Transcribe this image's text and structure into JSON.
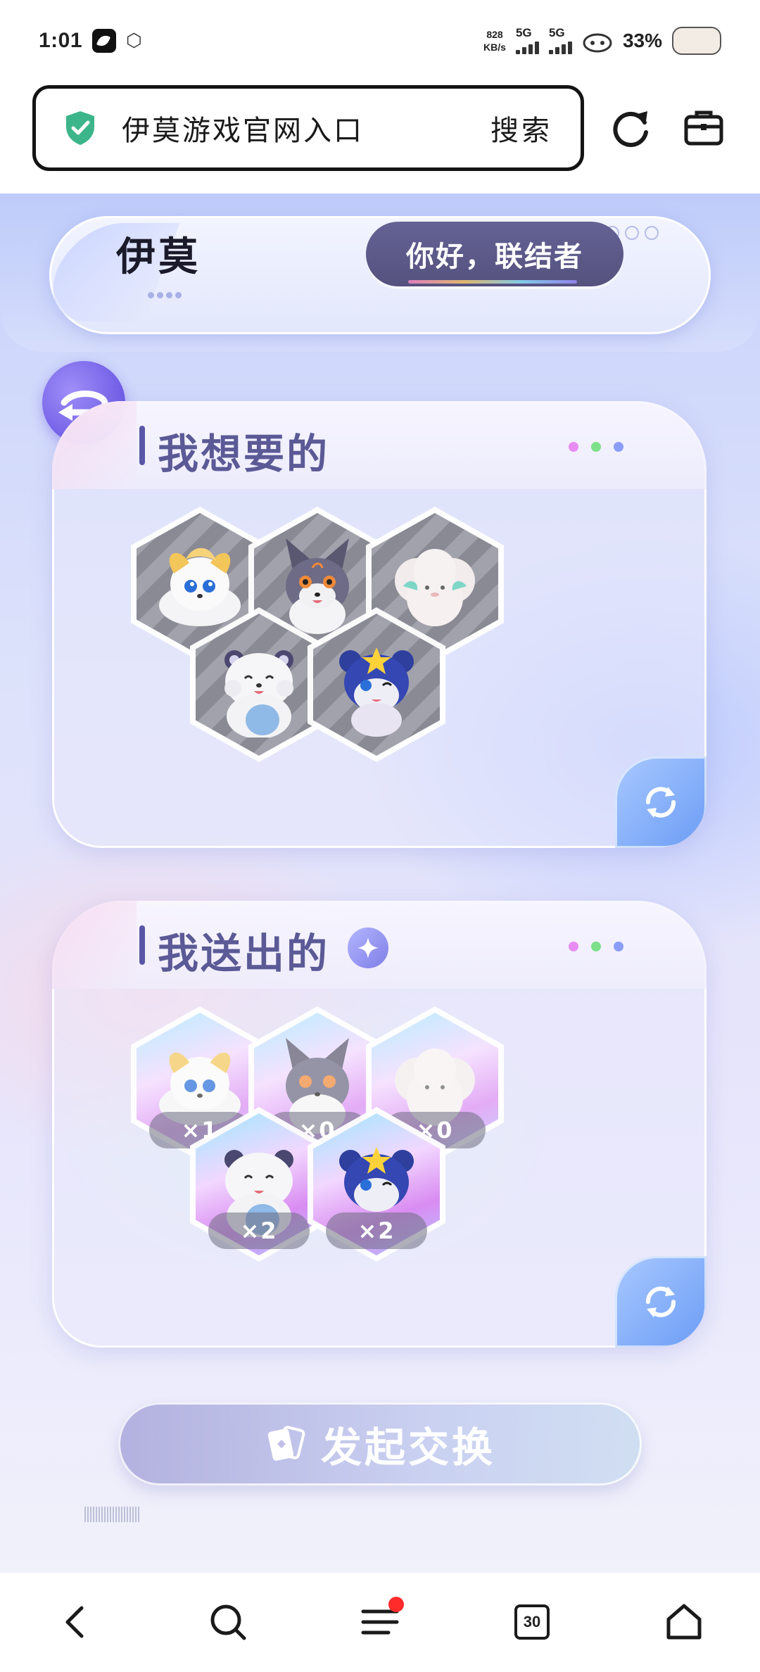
{
  "status_bar": {
    "time": "1:01",
    "net_speed_value": "828",
    "net_speed_unit": "KB/s",
    "signal_1": "5G",
    "signal_2": "5G",
    "battery": "33%"
  },
  "browser": {
    "address_text": "伊莫游戏官网入口",
    "search_label": "搜索"
  },
  "header": {
    "logo_text": "伊莫",
    "greeting": "你好，联结者"
  },
  "want_section": {
    "title": "我想要的",
    "items": [
      {
        "name": "cream-fox-creature"
      },
      {
        "name": "gray-fox-creature"
      },
      {
        "name": "fluffy-sheep-creature"
      },
      {
        "name": "white-bear-creature"
      },
      {
        "name": "blue-star-squirrel-creature"
      }
    ]
  },
  "give_section": {
    "title": "我送出的",
    "items": [
      {
        "name": "cream-fox-creature",
        "count": "×1"
      },
      {
        "name": "gray-fox-creature",
        "count": "×0"
      },
      {
        "name": "fluffy-sheep-creature",
        "count": "×0"
      },
      {
        "name": "white-bear-creature",
        "count": "×2"
      },
      {
        "name": "blue-star-squirrel-creature",
        "count": "×2"
      }
    ]
  },
  "exchange_button": {
    "label": "发起交换"
  },
  "bottom_nav": {
    "tab_count": "30"
  },
  "colors": {
    "title_purple": "#5b5a96",
    "greeting_bg": "#5f5c8c",
    "accent_blue": "#6b9cf5",
    "notification_red": "#ff2b2b"
  }
}
